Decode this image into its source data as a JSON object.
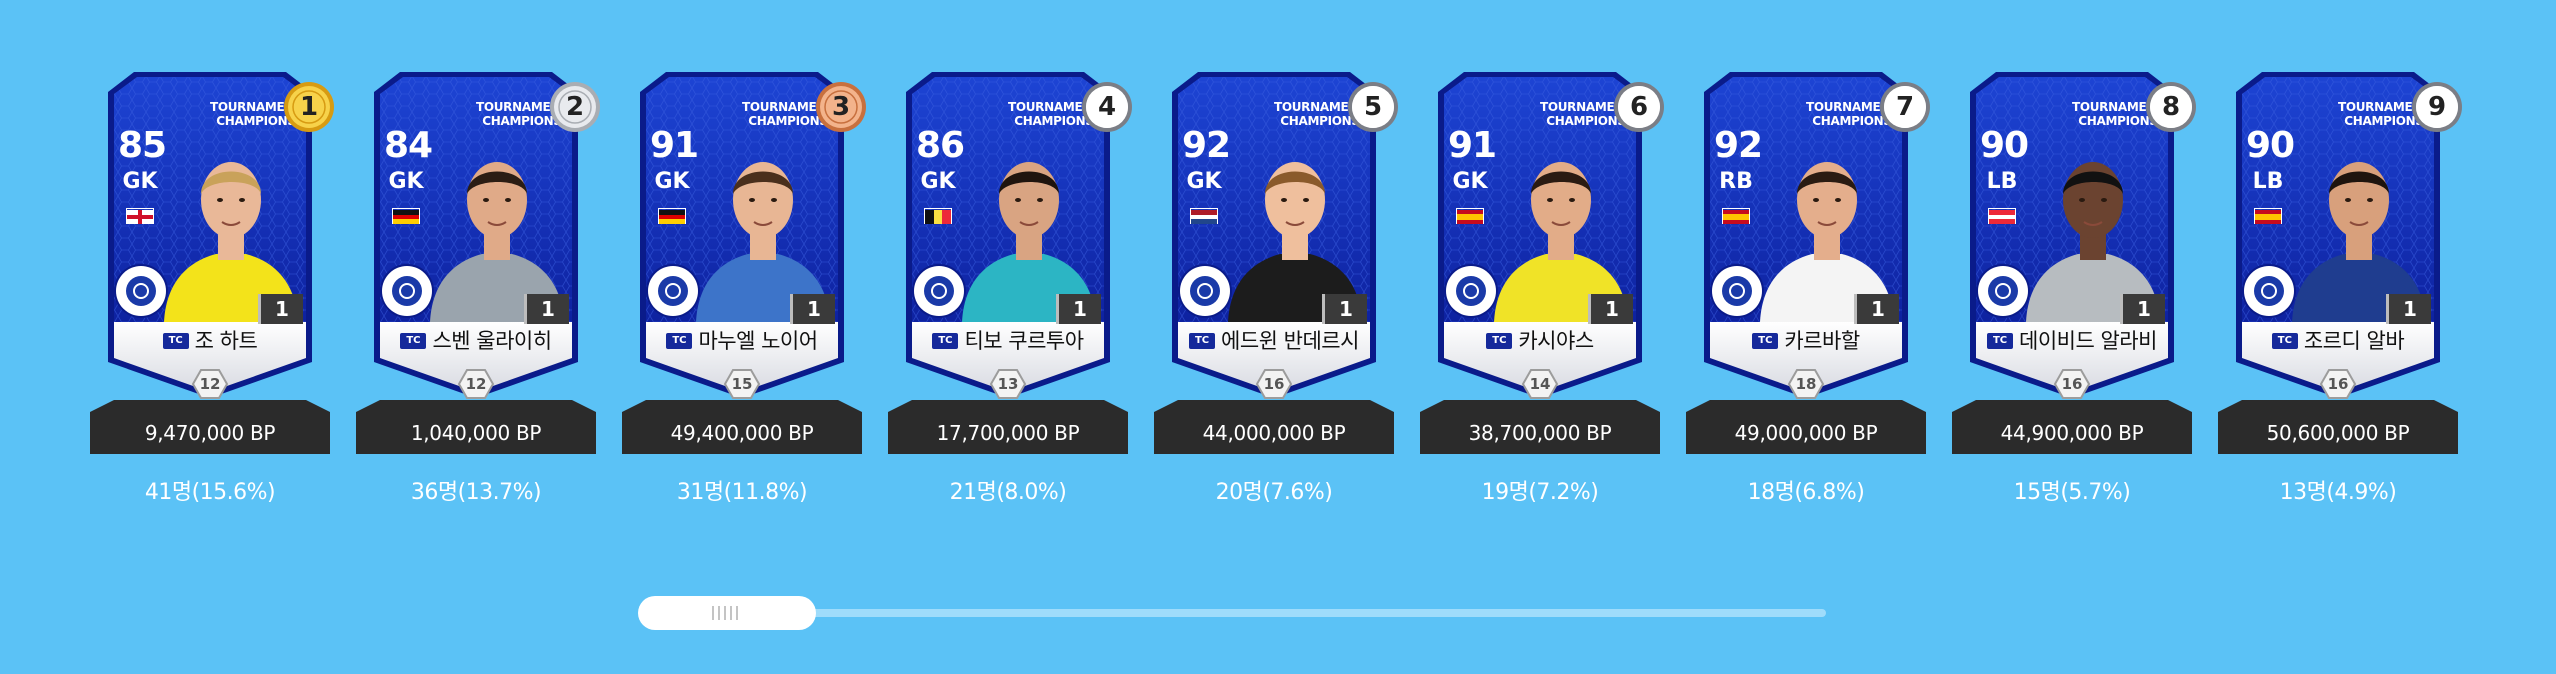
{
  "colors": {
    "background": "#5bc2f6",
    "card_blue": "#1130b8",
    "card_blue_dark": "#0a1b8a",
    "price_bar": "#2b2b2b",
    "medal_gold": "#f2c12e",
    "medal_silver": "#cfd3d8",
    "medal_bronze": "#e4976a"
  },
  "cards": [
    {
      "rank": "1",
      "rank_style": "gold",
      "header": "TOURNAMENT CHAMPIONS",
      "rating": "85",
      "position": "GK",
      "flag": "england",
      "club_icon": "premier-league-club-icon",
      "grade": "1",
      "badge": "TC",
      "name": "조 하트",
      "salary": "12",
      "price": "9,470,000 BP",
      "usage": "41명(15.6%)",
      "kit": "#f3e31a",
      "hair": "#c9a25a",
      "skin": "#e9b898"
    },
    {
      "rank": "2",
      "rank_style": "silver",
      "header": "TOURNAMENT CHAMPIONS",
      "rating": "84",
      "position": "GK",
      "flag": "germany",
      "club_icon": "club-crest-icon",
      "grade": "1",
      "badge": "TC",
      "name": "스벤 울라이히",
      "salary": "12",
      "price": "1,040,000 BP",
      "usage": "36명(13.7%)",
      "kit": "#9aa4ad",
      "hair": "#2b1d14",
      "skin": "#e0aa88"
    },
    {
      "rank": "3",
      "rank_style": "bronze",
      "header": "TOURNAMENT CHAMPIONS",
      "rating": "91",
      "position": "GK",
      "flag": "germany",
      "club_icon": "club-crest-icon",
      "grade": "1",
      "badge": "TC",
      "name": "마누엘 노이어",
      "salary": "15",
      "price": "49,400,000 BP",
      "usage": "31명(11.8%)",
      "kit": "#3d74c9",
      "hair": "#4a2f1c",
      "skin": "#e8b694"
    },
    {
      "rank": "4",
      "rank_style": "plain",
      "header": "TOURNAMENT CHAMPIONS",
      "rating": "86",
      "position": "GK",
      "flag": "belgium",
      "club_icon": "club-crest-icon",
      "grade": "1",
      "badge": "TC",
      "name": "티보 쿠르투아",
      "salary": "13",
      "price": "17,700,000 BP",
      "usage": "21명(8.0%)",
      "kit": "#2cb5c4",
      "hair": "#1f140e",
      "skin": "#d9a482"
    },
    {
      "rank": "5",
      "rank_style": "plain",
      "header": "TOURNAMENT CHAMPIONS",
      "rating": "92",
      "position": "GK",
      "flag": "netherlands",
      "club_icon": "club-crest-icon",
      "grade": "1",
      "badge": "TC",
      "name": "에드윈 반데르시",
      "salary": "16",
      "price": "44,000,000 BP",
      "usage": "20명(7.6%)",
      "kit": "#1c1c1c",
      "hair": "#8a5a2b",
      "skin": "#efbf9d"
    },
    {
      "rank": "6",
      "rank_style": "plain",
      "header": "TOURNAMENT CHAMPIONS",
      "rating": "91",
      "position": "GK",
      "flag": "spain",
      "club_icon": "club-crest-icon",
      "grade": "1",
      "badge": "TC",
      "name": "카시야스",
      "salary": "14",
      "price": "38,700,000 BP",
      "usage": "19명(7.2%)",
      "kit": "#f0e327",
      "hair": "#2a1b12",
      "skin": "#e2ac88"
    },
    {
      "rank": "7",
      "rank_style": "plain",
      "header": "TOURNAMENT CHAMPIONS",
      "rating": "92",
      "position": "RB",
      "flag": "spain",
      "club_icon": "club-crest-icon",
      "grade": "1",
      "badge": "TC",
      "name": "카르바할",
      "salary": "18",
      "price": "49,000,000 BP",
      "usage": "18명(6.8%)",
      "kit": "#f4f4f4",
      "hair": "#2a1b12",
      "skin": "#e4ae8c"
    },
    {
      "rank": "8",
      "rank_style": "plain",
      "header": "TOURNAMENT CHAMPIONS",
      "rating": "90",
      "position": "LB",
      "flag": "austria",
      "club_icon": "club-crest-icon",
      "grade": "1",
      "badge": "TC",
      "name": "데이비드 알라비",
      "salary": "16",
      "price": "44,900,000 BP",
      "usage": "15명(5.7%)",
      "kit": "#b7bcc0",
      "hair": "#111111",
      "skin": "#6b4330"
    },
    {
      "rank": "9",
      "rank_style": "plain",
      "header": "TOURNAMENT CHAMPIONS",
      "rating": "90",
      "position": "LB",
      "flag": "spain",
      "club_icon": "club-crest-icon",
      "grade": "1",
      "badge": "TC",
      "name": "조르디 알바",
      "salary": "16",
      "price": "50,600,000 BP",
      "usage": "13명(4.9%)",
      "kit": "#1f3d8f",
      "hair": "#1e140e",
      "skin": "#d8a07c"
    }
  ]
}
